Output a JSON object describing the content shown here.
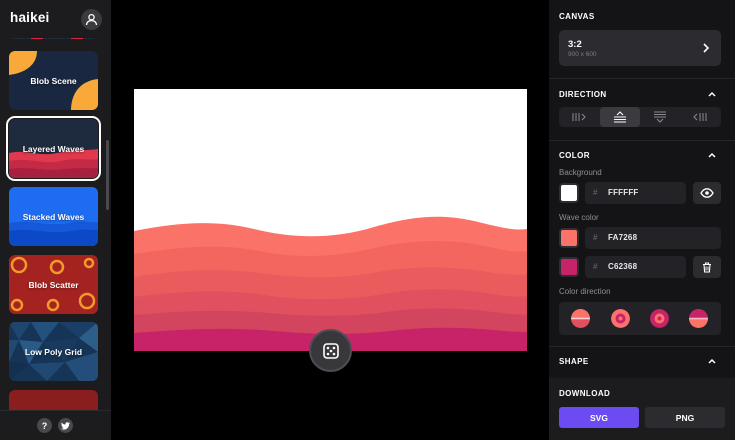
{
  "app": {
    "logo_text": "haikei"
  },
  "sidebar": {
    "generators": [
      {
        "label": "",
        "colors": {
          "bg": "#1e2a3e",
          "shape": "#d6283d"
        }
      },
      {
        "label": "Blob Scene",
        "colors": {
          "bg": "#1a2740",
          "shape": "#f8a93a"
        }
      },
      {
        "label": "Layered Waves",
        "colors": {
          "bg": "#1e2a3e",
          "shape": "#d6283d"
        }
      },
      {
        "label": "Stacked Waves",
        "colors": {
          "bg": "#1d6cf2",
          "shape": "#0b49c7"
        }
      },
      {
        "label": "Blob Scatter",
        "colors": {
          "bg": "#a4221f",
          "shape": "#f09a2a"
        }
      },
      {
        "label": "Low Poly Grid",
        "colors": {
          "bg": "#163456",
          "shape": "#2a5a86"
        }
      },
      {
        "label": "",
        "colors": {
          "bg": "#8a1e1e",
          "shape": "#8a1e1e"
        }
      }
    ],
    "selected_index": 2,
    "footer": {
      "help_label": "?"
    }
  },
  "canvas": {
    "background": "#FFFFFF",
    "wave_colors": [
      "#fa7268",
      "#f3665f",
      "#ea5b5e",
      "#e0505e",
      "#d3445f",
      "#c62368"
    ]
  },
  "panel": {
    "canvas_section": {
      "title": "CANVAS",
      "ratio": "3:2",
      "dimensions": "900 x 600"
    },
    "direction_section": {
      "title": "DIRECTION",
      "options": [
        "left-icon",
        "up-icon",
        "down-icon",
        "right-icon"
      ],
      "selected": 1
    },
    "color_section": {
      "title": "COLOR",
      "background_label": "Background",
      "background_hash": "#",
      "background_value": "FFFFFF",
      "background_color": "#FFFFFF",
      "wave_label": "Wave color",
      "wave1_hash": "#",
      "wave1_value": "FA7268",
      "wave1_color": "#FA7268",
      "wave2_hash": "#",
      "wave2_value": "C62368",
      "wave2_color": "#C62368",
      "direction_label": "Color direction"
    },
    "shape_section": {
      "title": "SHAPE"
    },
    "download_section": {
      "title": "DOWNLOAD",
      "svg_label": "SVG",
      "png_label": "PNG",
      "accent": "#6c4cf0"
    }
  }
}
